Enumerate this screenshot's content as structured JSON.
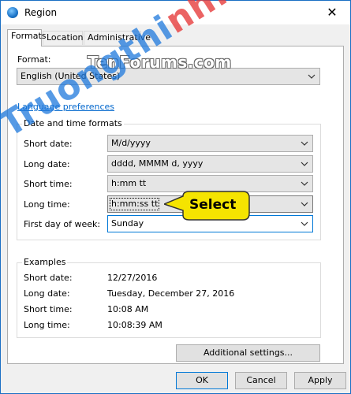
{
  "window": {
    "title": "Region",
    "close_glyph": "✕"
  },
  "tabs": [
    {
      "label": "Formats",
      "active": true
    },
    {
      "label": "Location",
      "active": false
    },
    {
      "label": "Administrative",
      "active": false
    }
  ],
  "format": {
    "label": "Format:",
    "value": "English (United States)"
  },
  "language_link": "Language preferences",
  "datetime": {
    "title": "Date and time formats",
    "short_date": {
      "label": "Short date:",
      "value": "M/d/yyyy"
    },
    "long_date": {
      "label": "Long date:",
      "value": "dddd, MMMM d, yyyy"
    },
    "short_time": {
      "label": "Short time:",
      "value": "h:mm tt"
    },
    "long_time": {
      "label": "Long time:",
      "value": "h:mm:ss tt"
    },
    "first_day": {
      "label": "First day of week:",
      "value": "Sunday"
    }
  },
  "callout": {
    "text": "Select",
    "color": "#f5e400"
  },
  "examples": {
    "title": "Examples",
    "rows": [
      {
        "label": "Short date:",
        "value": "12/27/2016"
      },
      {
        "label": "Long date:",
        "value": "Tuesday, December 27, 2016"
      },
      {
        "label": "Short time:",
        "value": "10:08 AM"
      },
      {
        "label": "Long time:",
        "value": "10:08:39 AM"
      }
    ]
  },
  "additional_settings": "Additional settings...",
  "buttons": {
    "ok": "OK",
    "cancel": "Cancel",
    "apply": "Apply"
  },
  "watermarks": {
    "tenforums": "TenForums.com",
    "site_part1": "Truongthi",
    "site_part2": "nh.top"
  },
  "colors": {
    "accent": "#0078d7",
    "link": "#0066cc",
    "border": "#adadad"
  }
}
